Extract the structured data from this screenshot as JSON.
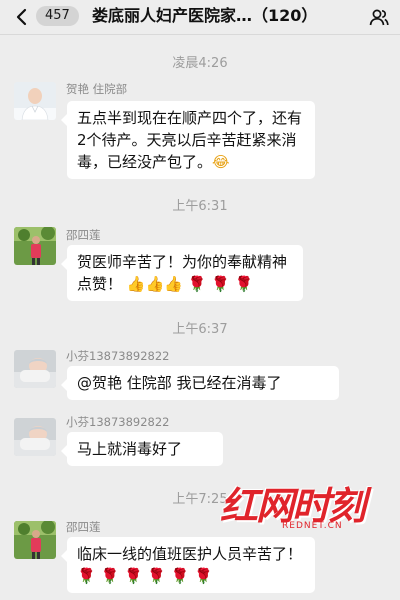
{
  "header": {
    "back_icon": "chevron-left-icon",
    "unread_count": "457",
    "title": "娄底丽人妇产医院家…（120）",
    "people_icon": "people-icon"
  },
  "messages": [
    {
      "time": "凌晨4:26",
      "sender": "贺艳  住院部",
      "text": "五点半到现在在顺产四个了，还有2个待产。天亮以后辛苦赶紧来消毒，已经没产包了。",
      "emoji": "😂"
    },
    {
      "time": "上午6:31",
      "sender": "邵四莲",
      "text": "贺医师辛苦了！为你的奉献精神点赞！",
      "emoji_thumbs": [
        "👍",
        "👍",
        "👍"
      ],
      "emoji_roses": [
        "🌹",
        "🌹",
        "🌹"
      ]
    },
    {
      "time": "上午6:37",
      "sender": "小芬13873892822",
      "text": "@贺艳 住院部 我已经在消毒了"
    },
    {
      "sender": "小芬13873892822",
      "text": "马上就消毒好了"
    },
    {
      "time": "上午7:25",
      "sender": "邵四莲",
      "text": "临床一线的值班医护人员辛苦了！",
      "emoji_roses": [
        "🌹",
        "🌹",
        "🌹",
        "🌹",
        "🌹",
        "🌹"
      ]
    }
  ],
  "watermark": {
    "text": "红网时刻",
    "subtext": "REDNET.CN"
  },
  "colors": {
    "background": "#ededed",
    "bubble": "#ffffff",
    "time": "#9d9d9d",
    "watermark": "#e0242b"
  }
}
